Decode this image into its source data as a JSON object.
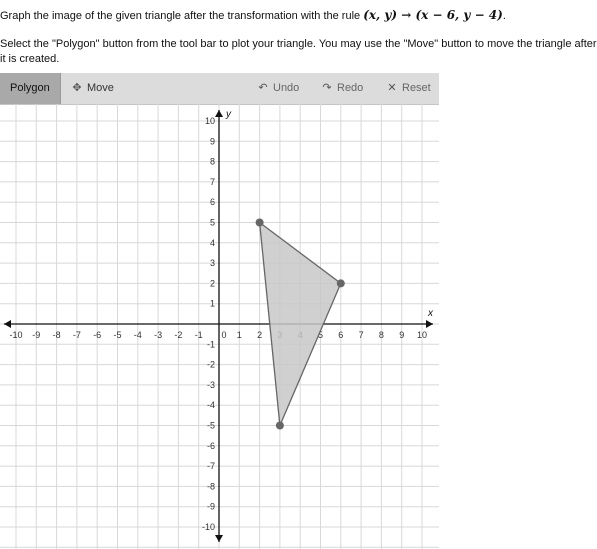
{
  "instructions": {
    "line1_prefix": "Graph the image of the given triangle after the transformation with the rule",
    "rule_math": "(x, y) → (x − 6, y − 4)",
    "line1_suffix": ".",
    "line2": "Select the \"Polygon\" button from the tool bar to plot your triangle. You may use the \"Move\" button to move the triangle after it is created."
  },
  "toolbar": {
    "polygon_label": "Polygon",
    "move_label": "Move",
    "move_icon": "move-arrows-icon",
    "undo_label": "Undo",
    "undo_icon": "undo-arrow-icon",
    "redo_label": "Redo",
    "redo_icon": "redo-arrow-icon",
    "reset_label": "Reset",
    "reset_icon": "close-x-icon"
  },
  "graph": {
    "x_axis_label": "x",
    "y_axis_label": "y",
    "x_min": -10,
    "x_max": 10,
    "y_min": -10,
    "y_max": 10,
    "x_ticks": [
      "-10",
      "-9",
      "-8",
      "-7",
      "-6",
      "-5",
      "-4",
      "-3",
      "-2",
      "-1",
      "0",
      "1",
      "2",
      "3",
      "4",
      "5",
      "6",
      "7",
      "8",
      "9",
      "10"
    ],
    "y_ticks": [
      "10",
      "9",
      "8",
      "7",
      "6",
      "5",
      "4",
      "3",
      "2",
      "1",
      "-1",
      "-2",
      "-3",
      "-4",
      "-5",
      "-6",
      "-7",
      "-8",
      "-9",
      "-10"
    ],
    "grid": true,
    "triangle": [
      [
        2,
        5
      ],
      [
        6,
        2
      ],
      [
        3,
        -5
      ]
    ],
    "triangle_fill": "#c8c8c8",
    "triangle_stroke": "#666666",
    "vertex_color": "#666666",
    "axis_color": "#111111",
    "grid_color": "#d8d8d8"
  }
}
